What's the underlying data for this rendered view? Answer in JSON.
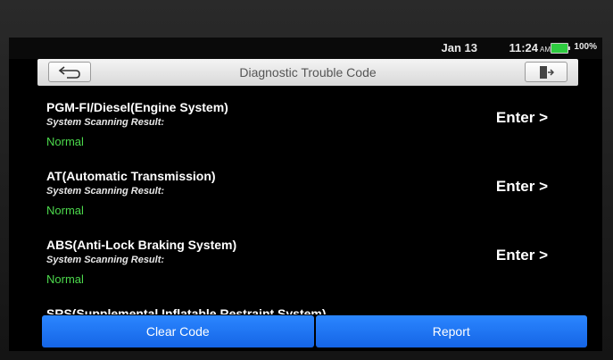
{
  "status": {
    "date": "Jan 13",
    "time": "11:24",
    "ampm": "AM",
    "battery": "100%"
  },
  "header": {
    "title": "Diagnostic Trouble Code",
    "back_icon": "back-arrow-icon",
    "exit_icon": "exit-door-icon"
  },
  "systems": [
    {
      "name": "PGM-FI/Diesel(Engine System)",
      "label": "System Scanning Result:",
      "result": "Normal",
      "action": "Enter >"
    },
    {
      "name": "AT(Automatic Transmission)",
      "label": "System Scanning Result:",
      "result": "Normal",
      "action": "Enter >"
    },
    {
      "name": "ABS(Anti-Lock Braking System)",
      "label": "System Scanning Result:",
      "result": "Normal",
      "action": "Enter >"
    },
    {
      "name": "SRS(Supplemental Inflatable Restraint System)"
    }
  ],
  "footer": {
    "clear_label": "Clear Code",
    "report_label": "Report"
  },
  "colors": {
    "accent": "#1a73f5",
    "status_ok": "#4cd94c",
    "battery": "#2ecc40"
  }
}
